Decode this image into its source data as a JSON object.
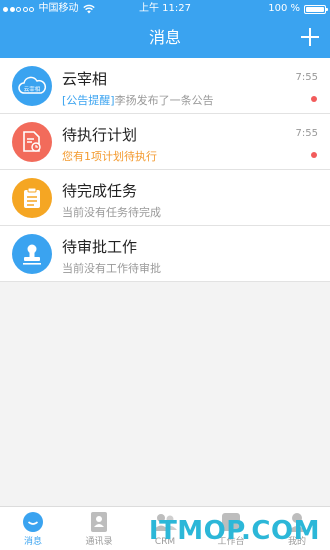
{
  "status_bar": {
    "carrier": "中国移动",
    "time": "上午 11:27",
    "battery": "100 %"
  },
  "nav": {
    "title": "消息",
    "add_icon": "plus-icon"
  },
  "messages": [
    {
      "title": "云宰相",
      "tag": "[公告提醒]",
      "subtitle": "李扬发布了一条公告",
      "time": "7:55",
      "unread": true,
      "icon": "cloud-logo-icon",
      "icon_text": "云宰相",
      "color": "#3aa3f0"
    },
    {
      "title": "待执行计划",
      "subtitle": "您有1项计划待执行",
      "time": "7:55",
      "unread": true,
      "icon": "plan-document-icon",
      "color": "#f26b5b",
      "subtitle_color": "#f39a2f"
    },
    {
      "title": "待完成任务",
      "subtitle": "当前没有任务待完成",
      "icon": "clipboard-icon",
      "color": "#f5a623"
    },
    {
      "title": "待审批工作",
      "subtitle": "当前没有工作待审批",
      "icon": "approval-stamp-icon",
      "color": "#3aa3f0"
    }
  ],
  "tabs": [
    {
      "label": "消息",
      "icon": "chat-icon",
      "active": true
    },
    {
      "label": "通讯录",
      "icon": "contacts-book-icon"
    },
    {
      "label": "CRM",
      "icon": "crm-people-icon"
    },
    {
      "label": "工作台",
      "icon": "workbench-icon"
    },
    {
      "label": "我的",
      "icon": "profile-icon"
    }
  ],
  "watermark": "ITMOP.COM"
}
